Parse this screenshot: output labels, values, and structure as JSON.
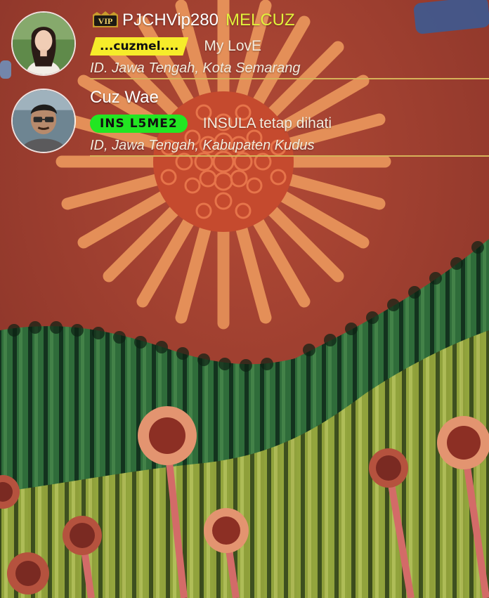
{
  "colors": {
    "divider": "#d6b25a",
    "tag_yellow": "#f6ec2a",
    "tag_green": "#22e622",
    "alias": "#e2f03c",
    "text": "#ffffff"
  },
  "members": [
    {
      "avatar_icon": "woman-portrait",
      "vip_badge": {
        "icon": "vip-crown-badge",
        "text": "VIP"
      },
      "username": "PJCHVip280",
      "alias": "MELCUZ",
      "tag": "...cuzmel....",
      "motto": "My LovE",
      "location": "ID. Jawa Tengah, Kota Semarang"
    },
    {
      "avatar_icon": "man-portrait",
      "username": "Cuz Wae",
      "tag": "INS  L5ME2",
      "motto": "INSULA tetap dihati",
      "location": "ID, Jawa Tengah, Kabupaten Kudus"
    }
  ]
}
